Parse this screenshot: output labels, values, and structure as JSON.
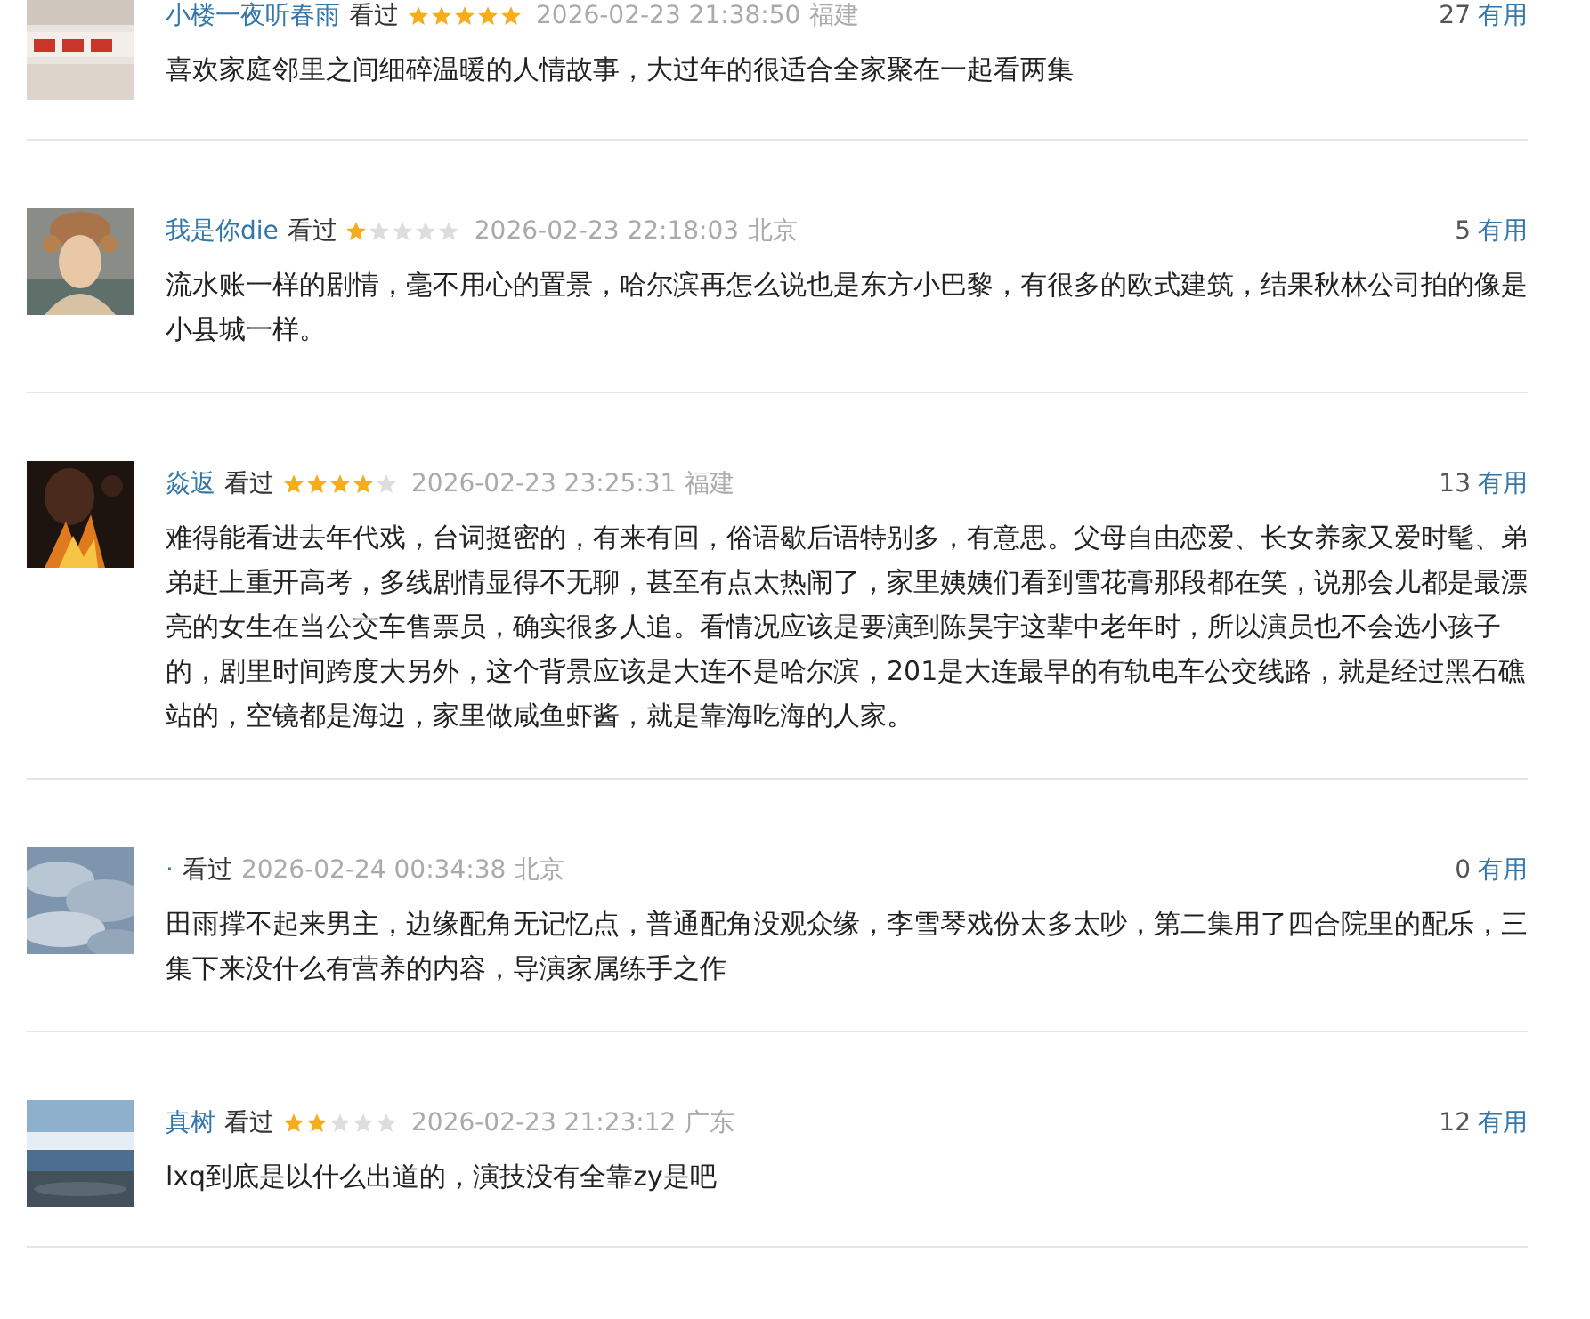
{
  "reviews": [
    {
      "user": "小楼一夜听春雨",
      "status": "看过",
      "stars": 5,
      "time": "2026-02-23 21:38:50",
      "location": "福建",
      "votes": "27",
      "vote_label": "有用",
      "text": "喜欢家庭邻里之间细碎温暖的人情故事，大过年的很适合全家聚在一起看两集"
    },
    {
      "user": "我是你die",
      "status": "看过",
      "stars": 1,
      "time": "2026-02-23 22:18:03",
      "location": "北京",
      "votes": "5",
      "vote_label": "有用",
      "text": "流水账一样的剧情，毫不用心的置景，哈尔滨再怎么说也是东方小巴黎，有很多的欧式建筑，结果秋林公司拍的像是小县城一样。"
    },
    {
      "user": "焱返",
      "status": "看过",
      "stars": 4,
      "time": "2026-02-23 23:25:31",
      "location": "福建",
      "votes": "13",
      "vote_label": "有用",
      "text": "难得能看进去年代戏，台词挺密的，有来有回，俗语歇后语特别多，有意思。父母自由恋爱、长女养家又爱时髦、弟弟赶上重开高考，多线剧情显得不无聊，甚至有点太热闹了，家里姨姨们看到雪花膏那段都在笑，说那会儿都是最漂亮的女生在当公交车售票员，确实很多人追。看情况应该是要演到陈昊宇这辈中老年时，所以演员也不会选小孩子的，剧里时间跨度大另外，这个背景应该是大连不是哈尔滨，201是大连最早的有轨电车公交线路，就是经过黑石礁站的，空镜都是海边，家里做咸鱼虾酱，就是靠海吃海的人家。"
    },
    {
      "user": "·",
      "status": "看过",
      "time": "2026-02-24 00:34:38",
      "location": "北京",
      "votes": "0",
      "vote_label": "有用",
      "text": "田雨撑不起来男主，边缘配角无记忆点，普通配角没观众缘，李雪琴戏份太多太吵，第二集用了四合院里的配乐，三集下来没什么有营养的内容，导演家属练手之作"
    },
    {
      "user": "真树",
      "status": "看过",
      "stars": 2,
      "time": "2026-02-23 21:23:12",
      "location": "广东",
      "votes": "12",
      "vote_label": "有用",
      "text": "lxq到底是以什么出道的，演技没有全靠zy是吧"
    }
  ]
}
